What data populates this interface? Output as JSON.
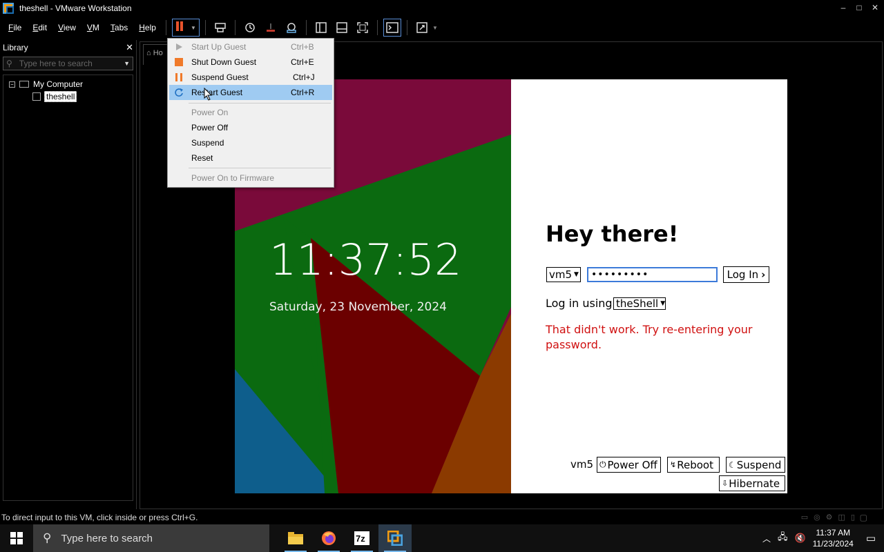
{
  "window": {
    "title": "theshell - VMware Workstation",
    "minimize": "‒",
    "maximize": "□",
    "close": "✕"
  },
  "menubar": {
    "items": [
      {
        "label": "File",
        "key": "F",
        "rest": "ile"
      },
      {
        "label": "Edit",
        "key": "E",
        "rest": "dit"
      },
      {
        "label": "View",
        "key": "V",
        "rest": "iew"
      },
      {
        "label": "VM",
        "key": "V",
        "rest": "M"
      },
      {
        "label": "Tabs",
        "key": "T",
        "rest": "abs"
      },
      {
        "label": "Help",
        "key": "H",
        "rest": "elp"
      }
    ]
  },
  "library": {
    "title": "Library",
    "close": "✕",
    "search_placeholder": "Type here to search",
    "tree": {
      "root": "My Computer",
      "child": "theshell"
    }
  },
  "tab": {
    "home_label": "Ho"
  },
  "power_menu": {
    "items": [
      {
        "label": "Start Up Guest",
        "shortcut": "Ctrl+B",
        "disabled": true,
        "icon": "play-icon"
      },
      {
        "label": "Shut Down Guest",
        "shortcut": "Ctrl+E",
        "disabled": false,
        "icon": "stop-icon"
      },
      {
        "label": "Suspend Guest",
        "shortcut": "Ctrl+J",
        "disabled": false,
        "icon": "pause-icon"
      },
      {
        "label": "Restart Guest",
        "shortcut": "Ctrl+R",
        "disabled": false,
        "highlighted": true,
        "icon": "restart-icon"
      },
      {
        "label": "Power On",
        "shortcut": "",
        "disabled": true
      },
      {
        "label": "Power Off",
        "shortcut": "",
        "disabled": false
      },
      {
        "label": "Suspend",
        "shortcut": "",
        "disabled": false
      },
      {
        "label": "Reset",
        "shortcut": "",
        "disabled": false
      },
      {
        "label": "Power On to Firmware",
        "shortcut": "",
        "disabled": true
      }
    ]
  },
  "guest": {
    "time": "11:37:52",
    "date": "Saturday, 23 November, 2024",
    "greeting": "Hey there!",
    "user_select": "vm5",
    "password_value": "•••••••••",
    "login_button": "Log In",
    "login_using_label": "Log in using",
    "session_select": "theShell",
    "error": "That didn't work. Try re-entering your password.",
    "hostname": "vm5",
    "power_off": "Power Off",
    "reboot": "Reboot",
    "suspend": "Suspend",
    "hibernate": "Hibernate"
  },
  "statusbar": {
    "text": "To direct input to this VM, click inside or press Ctrl+G."
  },
  "taskbar": {
    "search_placeholder": "Type here to search",
    "time": "11:37 AM",
    "date": "11/23/2024"
  },
  "colors": {
    "accent_orange": "#e8532b",
    "highlight": "#9fcbf2",
    "error_red": "#d01010",
    "focus_blue": "#3c7ad9"
  }
}
